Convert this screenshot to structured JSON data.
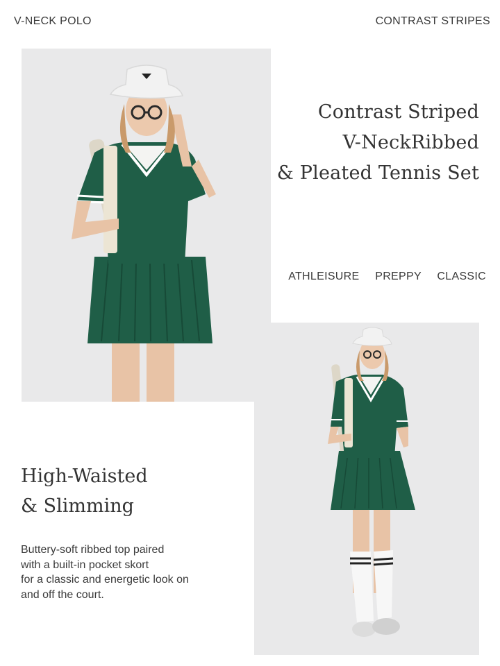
{
  "header": {
    "left_label": "V-NECK POLO",
    "right_label": "CONTRAST STRIPES"
  },
  "product": {
    "title_lines": [
      "Contrast Striped",
      "V-NeckRibbed",
      "& Pleated Tennis Set"
    ],
    "tags": [
      "ATHLEISURE",
      "PREPPY",
      "CLASSIC"
    ]
  },
  "feature": {
    "heading_lines": [
      "High-Waisted",
      "& Slimming"
    ],
    "description_lines": [
      "Buttery-soft ribbed top paired",
      "with a built-in pocket skort",
      "for a classic and energetic look on",
      "and off the court."
    ]
  },
  "colors": {
    "garment_green": "#1f5e47",
    "background_gray": "#e9e9ea",
    "text": "#333333"
  }
}
